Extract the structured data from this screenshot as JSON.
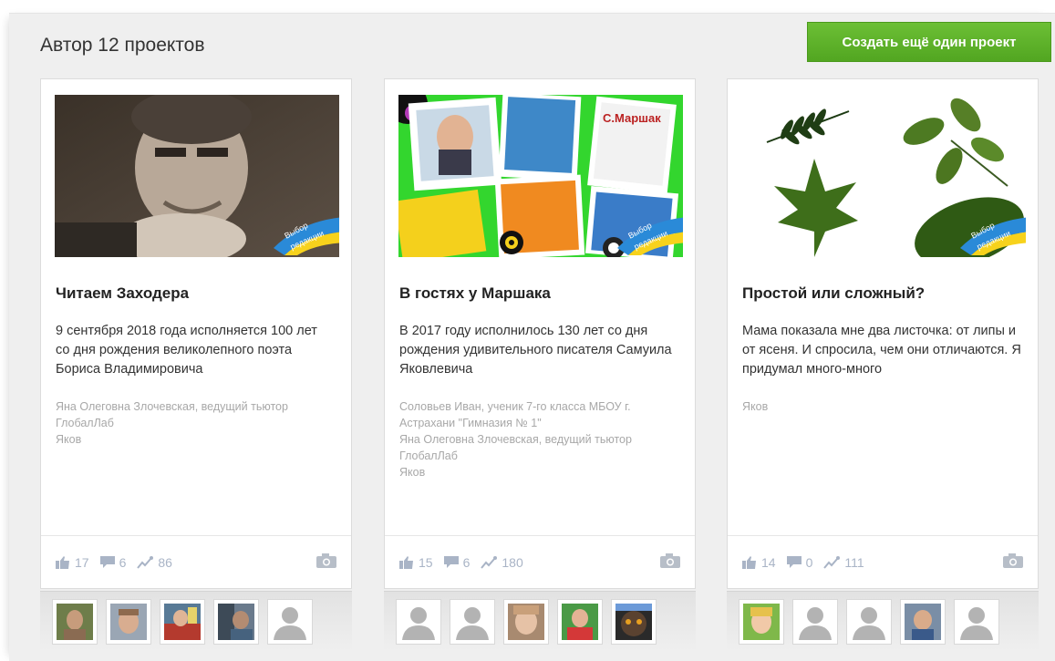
{
  "header": {
    "title": "Автор 12 проектов",
    "create_button": "Создать ещё один проект"
  },
  "badge": {
    "line1": "Выбор",
    "line2": "редакции"
  },
  "projects": [
    {
      "title": "Читаем Заходера",
      "description": "9 сентября 2018 года исполняется 100 лет со дня рождения великолепного поэта Бориса Владимировича",
      "authors": [
        "Яна Олеговна Злочевская, ведущий тьютор ГлобалЛаб",
        "Яков"
      ],
      "likes": "17",
      "comments": "6",
      "views": "86"
    },
    {
      "title": "В гостях у Маршака",
      "description": "В 2017 году исполнилось 130 лет со дня рождения удивительного писателя Самуила Яковлевича",
      "authors": [
        "Соловьев Иван, ученик 7-го класса МБОУ г. Астрахани \"Гимназия № 1\"",
        "Яна Олеговна Злочевская, ведущий тьютор ГлобалЛаб",
        "Яков"
      ],
      "likes": "15",
      "comments": "6",
      "views": "180"
    },
    {
      "title": "Простой или сложный?",
      "description": "Мама показала мне два листочка: от липы и от ясеня. И спросила, чем они отличаются. Я придумал много-много",
      "authors": [
        "Яков"
      ],
      "likes": "14",
      "comments": "0",
      "views": "111"
    }
  ],
  "icons": {
    "like": "thumbs-up-icon",
    "comment": "comment-icon",
    "views": "trend-icon",
    "camera": "camera-icon",
    "placeholder": "user-placeholder-icon"
  },
  "colors": {
    "accent_green": "#5cb02a",
    "stat_gray": "#a9b4c6"
  }
}
